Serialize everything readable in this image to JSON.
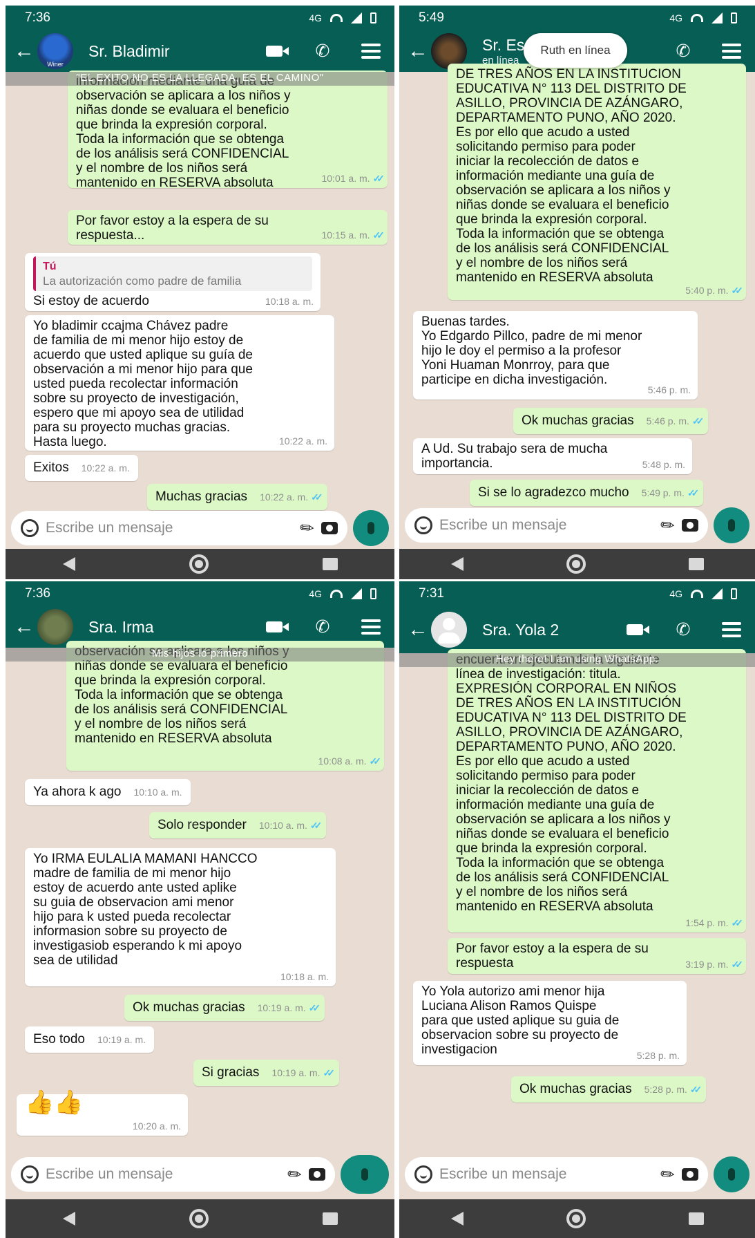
{
  "panels": {
    "p1": {
      "status_time": "7:36",
      "network": "4G",
      "contact": "Sr. Bladimir",
      "avatar_text": "Winer",
      "pinned": "\"EL EXITO NO ES LA LLEGADA, ES EL CAMINO\"",
      "placeholder": "Escribe un mensaje",
      "messages": [
        {
          "dir": "out",
          "text": "información mediante una guía de\nobservación se aplicara a los niños y\nniñas donde se evaluara el beneficio\nque brinda la expresión corporal.\nToda la información que se obtenga\nde los análisis será CONFIDENCIAL\ny el nombre de los niños será\nmantenido en RESERVA absoluta",
          "time": "10:01 a. m."
        },
        {
          "dir": "out",
          "text": "Por favor estoy a la espera de su\nrespuesta...",
          "time": "10:15 a. m."
        },
        {
          "dir": "in",
          "quote_author": "Tú",
          "quote_text": "La autorización como padre de familia",
          "text": "Si estoy de acuerdo",
          "time": "10:18 a. m."
        },
        {
          "dir": "in",
          "text": "Yo bladimir ccajma Chávez padre\nde familia de mi menor hijo estoy de\nacuerdo que usted aplique su guía de\nobservación a mi menor hijo para que\nusted pueda recolectar información\nsobre su proyecto de investigación,\nespero que mi apoyo sea de utilidad\npara su proyecto muchas gracias.\nHasta luego.",
          "time": "10:22 a. m."
        },
        {
          "dir": "in",
          "text": "Exitos",
          "time": "10:22 a. m."
        },
        {
          "dir": "out",
          "text": "Muchas gracias",
          "time": "10:22 a. m."
        }
      ]
    },
    "p2": {
      "status_time": "5:49",
      "network": "4G",
      "contact": "Sr. Esgardo",
      "subtitle": "en línea",
      "toast": "Ruth en línea",
      "pinned": "Ruth en línea",
      "placeholder": "Escribe un mensaje",
      "messages": [
        {
          "dir": "out",
          "text": "DE TRES AÑOS EN LA INSTITUCION\nEDUCATIVA N° 113 DEL DISTRITO DE\nASILLO, PROVINCIA DE AZÁNGARO,\nDEPARTAMENTO PUNO, AÑO 2020.\nEs por ello que acudo a usted\nsolicitando permiso para poder\niniciar la recolección de datos e\ninformación mediante una guía de\nobservación se aplicara a los niños y\nniñas donde se evaluara el beneficio\nque brinda la expresión corporal.\nToda la información que se obtenga\nde los análisis será CONFIDENCIAL\ny el nombre de los niños será\nmantenido en RESERVA absoluta",
          "time": "5:40 p. m."
        },
        {
          "dir": "in",
          "text": "Buenas tardes.\nYo Edgardo Pillco, padre de mi menor\nhijo le doy el permiso a la profesor\nYoni Huaman Monrroy, para que\nparticipe en dicha investigación.",
          "time": "5:46 p. m."
        },
        {
          "dir": "out",
          "text": "Ok muchas gracias",
          "time": "5:46 p. m."
        },
        {
          "dir": "in",
          "text": "A Ud. Su trabajo sera de mucha\nimportancia.",
          "time": "5:48 p. m."
        },
        {
          "dir": "out",
          "text": "Si se lo agradezco mucho",
          "time": "5:49 p. m."
        }
      ]
    },
    "p3": {
      "status_time": "7:36",
      "network": "4G",
      "contact": "Sra. Irma",
      "pinned": "Mis hijos lo primero",
      "placeholder": "Escribe un mensaje",
      "messages": [
        {
          "dir": "out",
          "text": "observación se aplicara a los niños y\nniñas donde se evaluara el beneficio\nque brinda la expresión corporal.\nToda la información que se obtenga\nde los análisis será CONFIDENCIAL\ny el nombre de los niños será\nmantenido en RESERVA absoluta",
          "time": "10:08 a. m."
        },
        {
          "dir": "in",
          "text": "Ya ahora k ago",
          "time": "10:10 a. m."
        },
        {
          "dir": "out",
          "text": "Solo responder",
          "time": "10:10 a. m."
        },
        {
          "dir": "in",
          "text": "Yo IRMA EULALIA MAMANI HANCCO\nmadre de familia de mi menor hijo\nestoy de acuerdo ante usted aplike\nsu guia de observacion ami menor\nhijo para k usted pueda recolectar\ninformasion sobre su proyecto de\ninvestigasiob esperando k mi apoyo\nsea de utilidad",
          "time": "10:18 a. m."
        },
        {
          "dir": "out",
          "text": "Ok muchas gracias",
          "time": "10:19 a. m."
        },
        {
          "dir": "in",
          "text": "Eso todo",
          "time": "10:19 a. m."
        },
        {
          "dir": "out",
          "text": "Si gracias",
          "time": "10:19 a. m."
        },
        {
          "dir": "in",
          "text": "👍👍",
          "time": "10:20 a. m."
        }
      ]
    },
    "p4": {
      "status_time": "7:31",
      "network": "4G",
      "contact": "Sra. Yola 2",
      "pinned": "Hey there! I am using WhatsApp.",
      "placeholder": "Escribe un mensaje",
      "messages": [
        {
          "dir": "out",
          "text": "encuentran ejecutando la siguiente\nlínea de investigación: titula.\nEXPRESIÓN CORPORAL EN NIÑOS\nDE TRES AÑOS EN LA INSTITUCIÓN\nEDUCATIVA N° 113 DEL DISTRITO DE\nASILLO, PROVINCIA DE AZÁNGARO,\nDEPARTAMENTO PUNO, AÑO 2020.\nEs por ello que acudo a usted\nsolicitando permiso para poder\niniciar la recolección de datos e\ninformación mediante una guía de\nobservación se aplicara a los niños y\nniñas donde se evaluara el beneficio\nque brinda la expresión corporal.\nToda la información que se obtenga\nde los análisis será CONFIDENCIAL\ny el nombre de los niños será\nmantenido en RESERVA absoluta",
          "time": "1:54 p. m."
        },
        {
          "dir": "out",
          "text": "Por favor estoy a la espera de su\nrespuesta",
          "time": "3:19 p. m."
        },
        {
          "dir": "in",
          "text": "Yo Yola autorizo ami menor hija\nLuciana Alison Ramos Quispe\npara que usted aplique su guia de\nobservacion sobre su proyecto de\ninvestigacion",
          "time": "5:28 p. m."
        },
        {
          "dir": "out",
          "text": "Ok muchas gracias",
          "time": "5:28 p. m."
        }
      ]
    }
  }
}
